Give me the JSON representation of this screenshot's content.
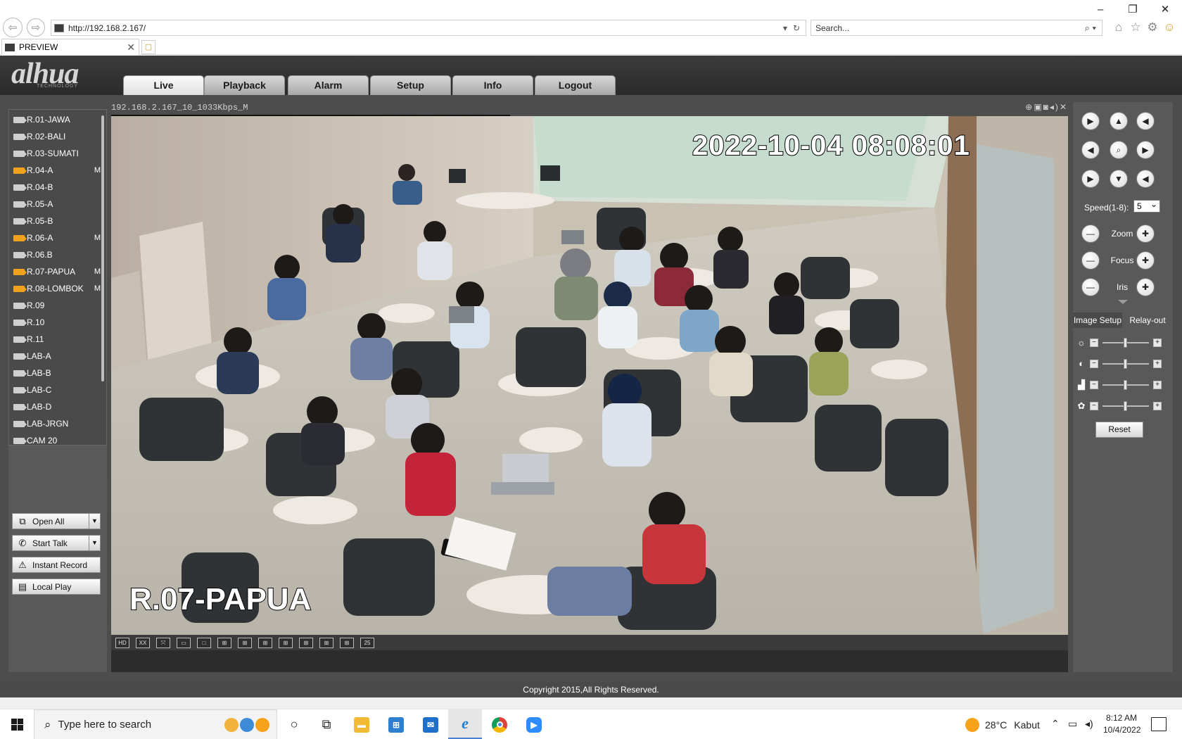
{
  "browser": {
    "url": "http://192.168.2.167/",
    "search_placeholder": "Search...",
    "tab_title": "PREVIEW"
  },
  "app": {
    "logo": "alhua",
    "logo_sub": "TECHNOLOGY",
    "tabs": [
      "Live",
      "Playback",
      "Alarm",
      "Setup",
      "Info",
      "Logout"
    ],
    "active_tab": "Live",
    "devices": [
      {
        "label": "R.01-JAWA",
        "recording": false,
        "flag": ""
      },
      {
        "label": "R.02-BALI",
        "recording": false,
        "flag": ""
      },
      {
        "label": "R.03-SUMATI",
        "recording": false,
        "flag": ""
      },
      {
        "label": "R.04-A",
        "recording": true,
        "flag": "M"
      },
      {
        "label": "R.04-B",
        "recording": false,
        "flag": ""
      },
      {
        "label": "R.05-A",
        "recording": false,
        "flag": ""
      },
      {
        "label": "R.05-B",
        "recording": false,
        "flag": ""
      },
      {
        "label": "R.06-A",
        "recording": true,
        "flag": "M"
      },
      {
        "label": "R.06.B",
        "recording": false,
        "flag": ""
      },
      {
        "label": "R.07-PAPUA",
        "recording": true,
        "flag": "M"
      },
      {
        "label": "R.08-LOMBOK",
        "recording": true,
        "flag": "M"
      },
      {
        "label": "R.09",
        "recording": false,
        "flag": ""
      },
      {
        "label": "R.10",
        "recording": false,
        "flag": ""
      },
      {
        "label": "R.11",
        "recording": false,
        "flag": ""
      },
      {
        "label": "LAB-A",
        "recording": false,
        "flag": ""
      },
      {
        "label": "LAB-B",
        "recording": false,
        "flag": ""
      },
      {
        "label": "LAB-C",
        "recording": false,
        "flag": ""
      },
      {
        "label": "LAB-D",
        "recording": false,
        "flag": ""
      },
      {
        "label": "LAB-JRGN",
        "recording": false,
        "flag": ""
      },
      {
        "label": "CAM 20",
        "recording": false,
        "flag": ""
      }
    ],
    "controls": {
      "open_all": "Open All",
      "start_talk": "Start Talk",
      "instant_record": "Instant Record",
      "local_play": "Local Play"
    },
    "video": {
      "stream_title": "192.168.2.167_10_1033Kbps_M",
      "timestamp": "2022-10-04 08:08:01",
      "camera_name": "R.07-PAPUA"
    },
    "layout_icons": [
      "HD",
      "XX",
      "⤧",
      "▭",
      "□",
      "⊞",
      "⊞",
      "⊞",
      "⊞",
      "⊞",
      "⊞",
      "⊞",
      "25"
    ],
    "ptz": {
      "speed_label": "Speed(1-8):",
      "speed_value": "5",
      "zoom": "Zoom",
      "focus": "Focus",
      "iris": "Iris"
    },
    "image_tabs": [
      "Image Setup",
      "Relay-out"
    ],
    "image_setup": [
      {
        "name": "brightness",
        "level": 0.5
      },
      {
        "name": "contrast",
        "level": 0.5
      },
      {
        "name": "saturation",
        "level": 0.5
      },
      {
        "name": "hue",
        "level": 0.5
      }
    ],
    "reset_label": "Reset",
    "copyright": "Copyright 2015,All Rights Reserved."
  },
  "taskbar": {
    "search_placeholder": "Type here to search",
    "weather_temp": "28°C",
    "weather_desc": "Kabut",
    "time": "8:12 AM",
    "date": "10/4/2022"
  },
  "colors": {
    "recording_camera": "#f0a21a",
    "panel_bg": "#4d4d4d",
    "taskbar_active": "#4a7fd4"
  }
}
